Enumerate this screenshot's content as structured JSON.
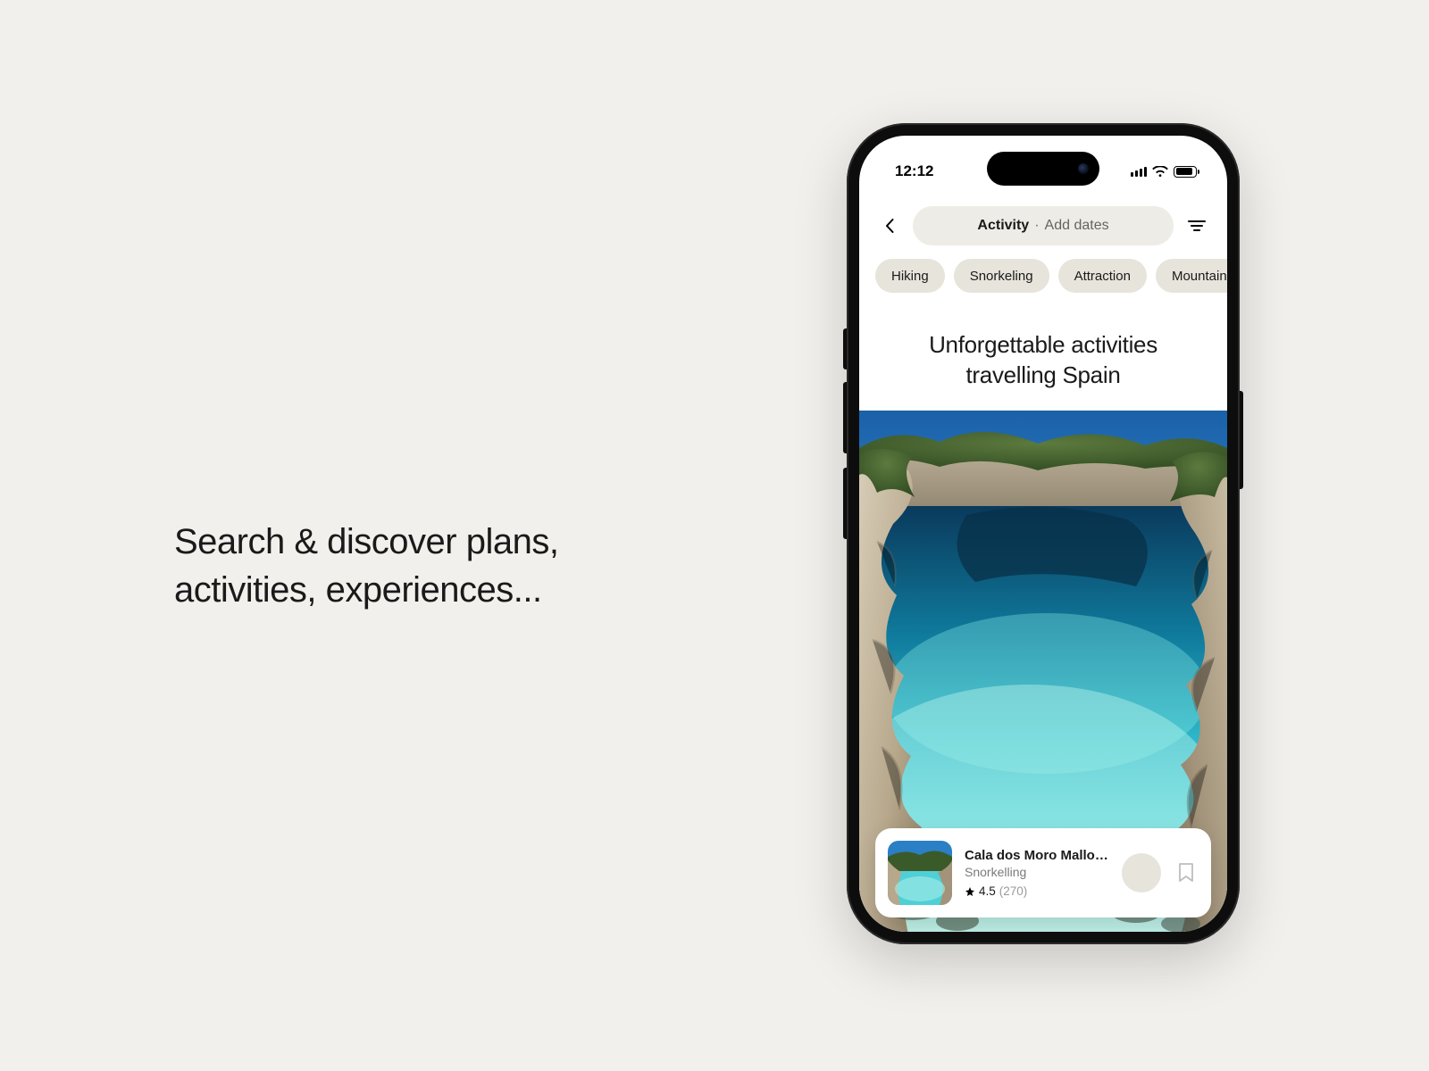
{
  "marketing": {
    "headline_line1": "Search & discover plans,",
    "headline_line2": "activities, experiences..."
  },
  "status_bar": {
    "time": "12:12"
  },
  "search": {
    "label": "Activity",
    "hint": "Add dates"
  },
  "chips": [
    "Hiking",
    "Snorkeling",
    "Attraction",
    "Mountain Bi"
  ],
  "heading": {
    "line1": "Unforgettable activities",
    "line2": "travelling Spain"
  },
  "card": {
    "title": "Cala dos Moro Mallorca",
    "category": "Snorkelling",
    "rating": "4.5",
    "reviews": "(270)"
  }
}
